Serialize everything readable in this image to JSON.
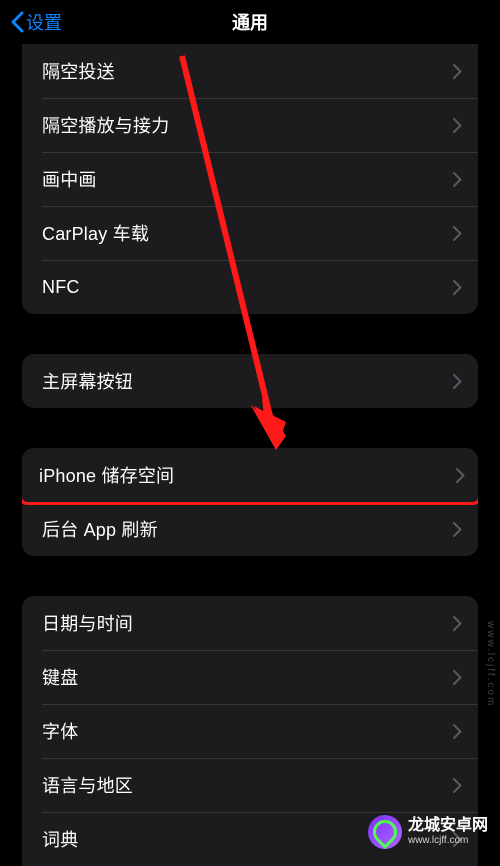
{
  "nav": {
    "back_label": "设置",
    "title": "通用"
  },
  "groups": {
    "g1": [
      {
        "label": "隔空投送"
      },
      {
        "label": "隔空播放与接力"
      },
      {
        "label": "画中画"
      },
      {
        "label": "CarPlay 车载"
      },
      {
        "label": "NFC"
      }
    ],
    "g2": [
      {
        "label": "主屏幕按钮"
      }
    ],
    "g3": [
      {
        "label": "iPhone 储存空间",
        "highlighted": true
      },
      {
        "label": "后台 App 刷新"
      }
    ],
    "g4": [
      {
        "label": "日期与时间"
      },
      {
        "label": "键盘"
      },
      {
        "label": "字体"
      },
      {
        "label": "语言与地区"
      },
      {
        "label": "词典"
      }
    ]
  },
  "watermark": {
    "right": "www.lcjff.com",
    "name": "龙城安卓网",
    "url": "www.lcjff.com"
  },
  "annotation": {
    "arrow_color": "#ff1a1a",
    "highlight_color": "#ff1a1a"
  }
}
